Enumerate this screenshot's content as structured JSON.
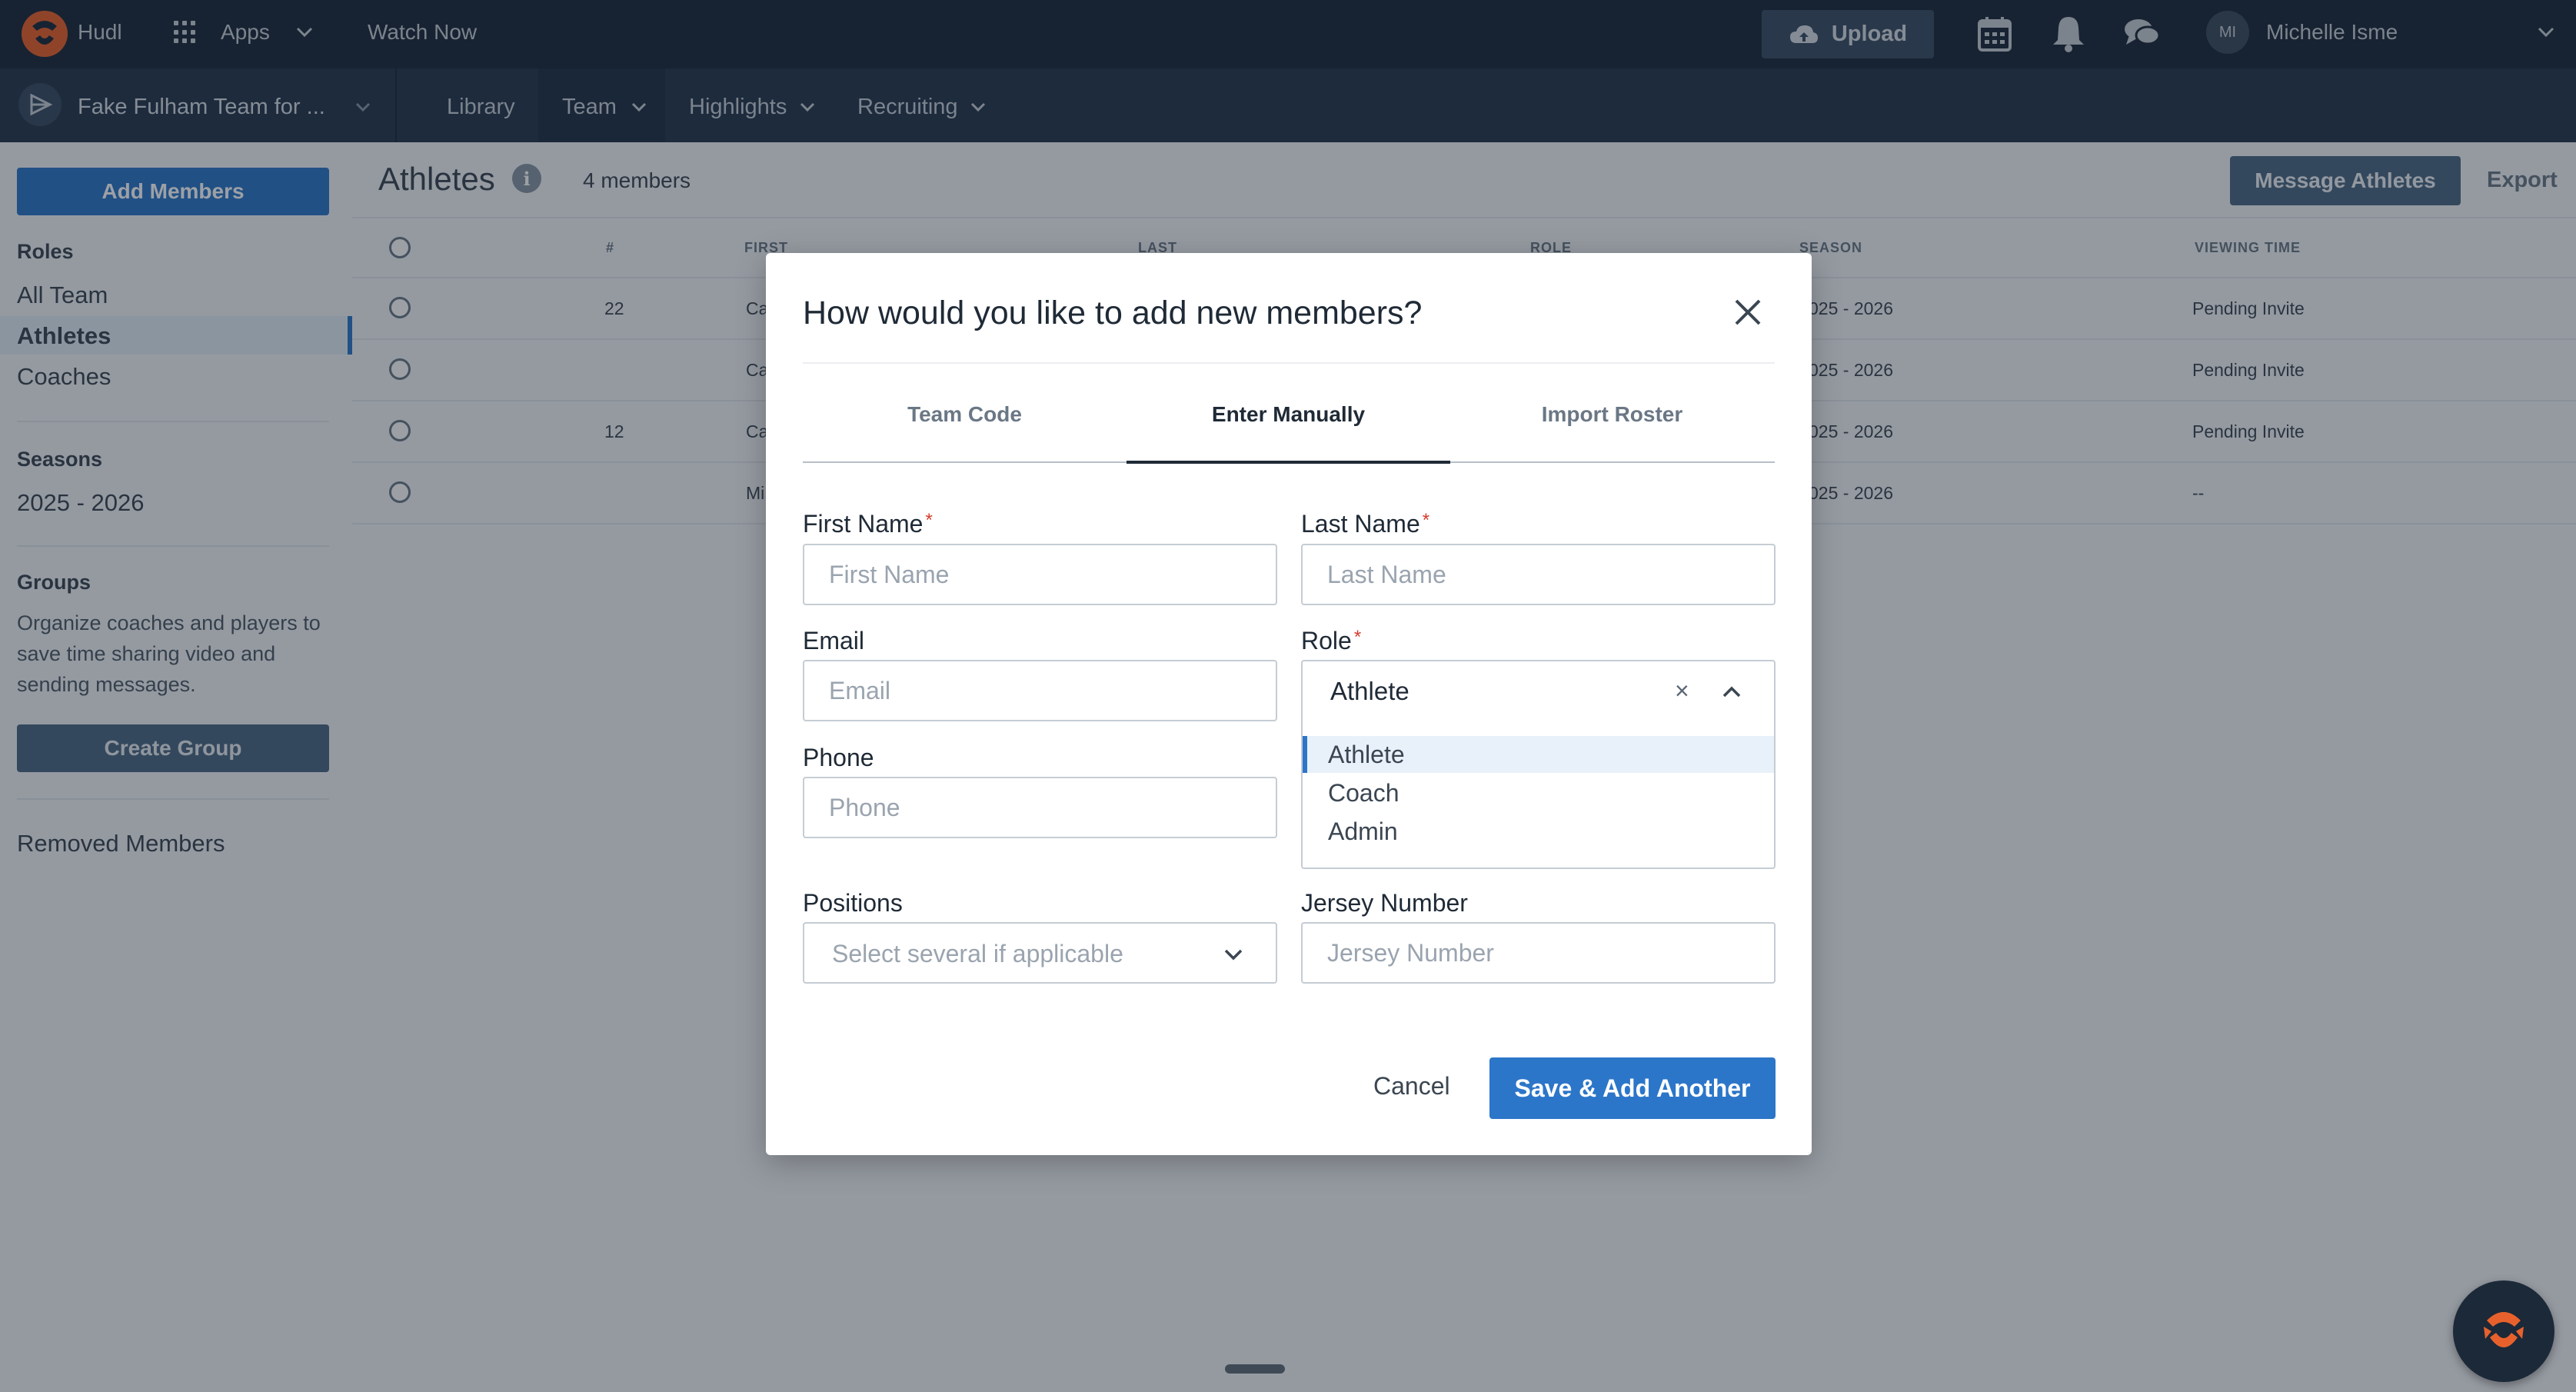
{
  "topbar": {
    "brand": "Hudl",
    "apps": "Apps",
    "watch_now": "Watch Now",
    "upload": "Upload",
    "avatar_initials": "MI",
    "user_name": "Michelle Isme"
  },
  "subnav": {
    "team_name": "Fake Fulham Team for ...",
    "items": [
      "Library",
      "Team",
      "Highlights",
      "Recruiting"
    ]
  },
  "sidebar": {
    "add_members": "Add Members",
    "roles_heading": "Roles",
    "roles": [
      "All Team",
      "Athletes",
      "Coaches"
    ],
    "seasons_heading": "Seasons",
    "season": "2025 - 2026",
    "groups_heading": "Groups",
    "groups_text": "Organize coaches and players to save time sharing video and sending messages.",
    "create_group": "Create Group",
    "removed_members": "Removed Members"
  },
  "main": {
    "title": "Athletes",
    "member_count": "4 members",
    "message_athletes": "Message Athletes",
    "export": "Export",
    "columns": [
      "#",
      "FIRST",
      "LAST",
      "ROLE",
      "SEASON",
      "VIEWING TIME"
    ],
    "rows": [
      {
        "number": "22",
        "first": "Ca",
        "season": "025 - 2026",
        "viewing": "Pending Invite"
      },
      {
        "number": "",
        "first": "Ca",
        "season": "025 - 2026",
        "viewing": "Pending Invite"
      },
      {
        "number": "12",
        "first": "Ca",
        "season": "025 - 2026",
        "viewing": "Pending Invite"
      },
      {
        "number": "",
        "first": "Mi",
        "season": "025 - 2026",
        "viewing": "--"
      }
    ]
  },
  "modal": {
    "title": "How would you like to add new members?",
    "tabs": [
      "Team Code",
      "Enter Manually",
      "Import Roster"
    ],
    "active_tab": "Enter Manually",
    "first_name_label": "First Name",
    "first_name_placeholder": "First Name",
    "last_name_label": "Last Name",
    "last_name_placeholder": "Last Name",
    "email_label": "Email",
    "email_placeholder": "Email",
    "role_label": "Role",
    "role_value": "Athlete",
    "role_clear": "×",
    "role_options": [
      "Athlete",
      "Coach",
      "Admin"
    ],
    "phone_label": "Phone",
    "phone_placeholder": "Phone",
    "positions_label": "Positions",
    "positions_placeholder": "Select several if applicable",
    "jersey_label": "Jersey Number",
    "jersey_placeholder": "Jersey Number",
    "required_mark": "*",
    "cancel": "Cancel",
    "save_add_another": "Save & Add Another"
  },
  "colors": {
    "topbar": "#1b2939",
    "subnav": "#25364d",
    "primary": "#2c76c9",
    "required": "#d33c2c",
    "accent_logo": "#e8612c"
  }
}
